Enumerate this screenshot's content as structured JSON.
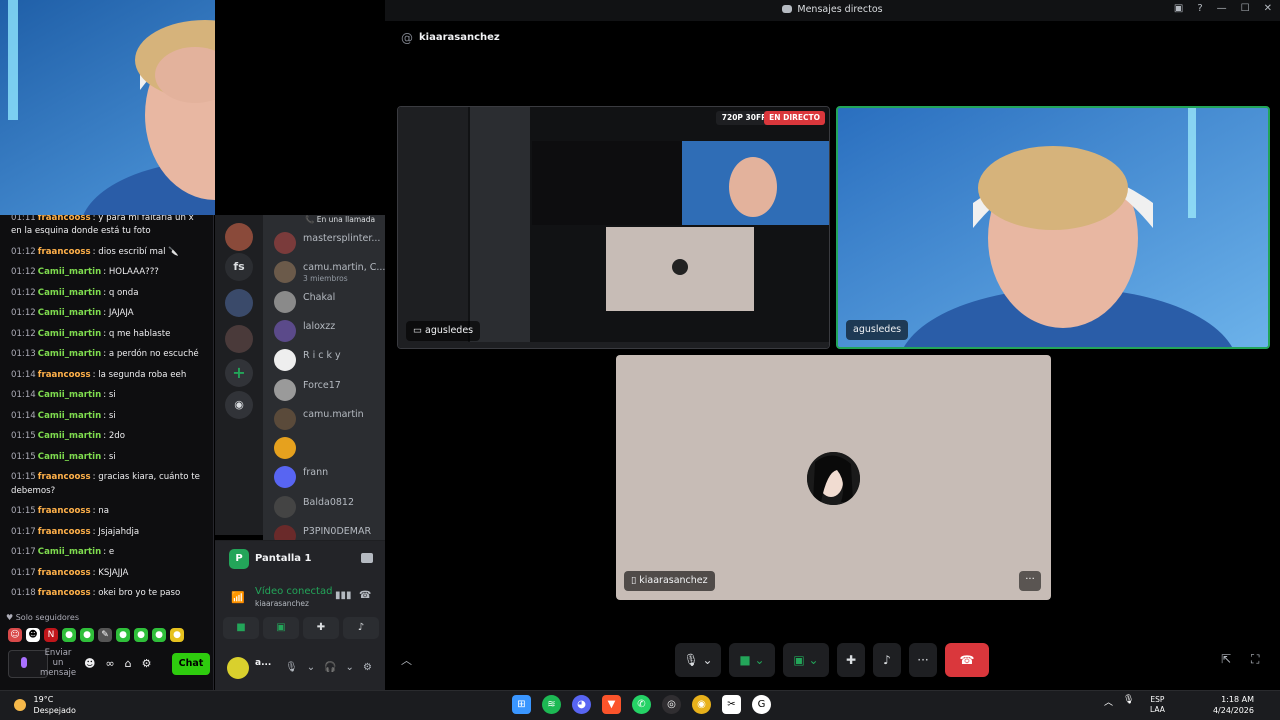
{
  "stream_chat": {
    "messages": [
      {
        "time": "01:11",
        "user": "fraancooss",
        "color": "orange",
        "text": "y para mi faltaría un x en la esquina donde está tu foto"
      },
      {
        "time": "01:12",
        "user": "fraancooss",
        "color": "orange",
        "text": "dios escribí mal 🔪"
      },
      {
        "time": "01:12",
        "user": "Camii_martin",
        "color": "green",
        "text": "HOLAAA???"
      },
      {
        "time": "01:12",
        "user": "Camii_martin",
        "color": "green",
        "text": "q onda"
      },
      {
        "time": "01:12",
        "user": "Camii_martin",
        "color": "green",
        "text": "JAJAJA"
      },
      {
        "time": "01:12",
        "user": "Camii_martin",
        "color": "green",
        "text": "q me hablaste"
      },
      {
        "time": "01:13",
        "user": "Camii_martin",
        "color": "green",
        "text": "a perdón no escuché"
      },
      {
        "time": "01:14",
        "user": "fraancooss",
        "color": "orange",
        "text": "la segunda roba eeh"
      },
      {
        "time": "01:14",
        "user": "Camii_martin",
        "color": "green",
        "text": "si"
      },
      {
        "time": "01:14",
        "user": "Camii_martin",
        "color": "green",
        "text": "si"
      },
      {
        "time": "01:15",
        "user": "Camii_martin",
        "color": "green",
        "text": "2do"
      },
      {
        "time": "01:15",
        "user": "Camii_martin",
        "color": "green",
        "text": "si"
      },
      {
        "time": "01:15",
        "user": "fraancooss",
        "color": "orange",
        "text": "gracias kiara, cuánto te debemos?"
      },
      {
        "time": "01:15",
        "user": "fraancooss",
        "color": "orange",
        "text": "na"
      },
      {
        "time": "01:17",
        "user": "fraancooss",
        "color": "orange",
        "text": "Jsjajahdja"
      },
      {
        "time": "01:17",
        "user": "Camii_martin",
        "color": "green",
        "text": "e"
      },
      {
        "time": "01:17",
        "user": "fraancooss",
        "color": "orange",
        "text": "KSJAJJA"
      },
      {
        "time": "01:18",
        "user": "fraancooss",
        "color": "orange",
        "text": "okei bro yo te paso"
      }
    ],
    "followers_only": "Solo seguidores",
    "send_placeholder": "Enviar un mensaje",
    "chat_button": "Chat"
  },
  "window": {
    "title": "Mensajes directos"
  },
  "server_rail": {
    "fs_label": "fs"
  },
  "dm_list": {
    "in_call_label": "En una llamada",
    "items": [
      {
        "name": "mastersplinter...",
        "sub": ""
      },
      {
        "name": "camu.martin, C...",
        "sub": "3 miembros"
      },
      {
        "name": "Chakal",
        "sub": ""
      },
      {
        "name": "laloxzz",
        "sub": ""
      },
      {
        "name": "R i c k y",
        "sub": ""
      },
      {
        "name": "Force17",
        "sub": ""
      },
      {
        "name": "camu.martin",
        "sub": ""
      },
      {
        "name": "",
        "sub": ""
      },
      {
        "name": "frann",
        "sub": ""
      },
      {
        "name": "Balda0812",
        "sub": ""
      },
      {
        "name": "P3PIN0DEMAR",
        "sub": ""
      }
    ]
  },
  "voice_panel": {
    "screen_label": "Pantalla 1",
    "status": "Vídeo conectad",
    "status_sub": "kiaarasanchez",
    "user_name": "a..."
  },
  "channel": {
    "name": "kiaarasanchez"
  },
  "tiles": {
    "stream_user": "agusledes",
    "stream_quality": "720P 30FPS",
    "live_badge": "EN DIRECTO",
    "cam_user": "agusledes",
    "avatar_user": "kiaarasanchez",
    "more_label": "···"
  },
  "taskbar": {
    "temperature": "19°C",
    "weather": "Despejado",
    "lang_1": "ESP",
    "lang_2": "LAA",
    "time": "1:18 AM",
    "date": "4/24/2026"
  },
  "colors": {
    "discord_green": "#23a559",
    "discord_red": "#da373c",
    "twitch_chat_button": "#2ecc0e"
  }
}
